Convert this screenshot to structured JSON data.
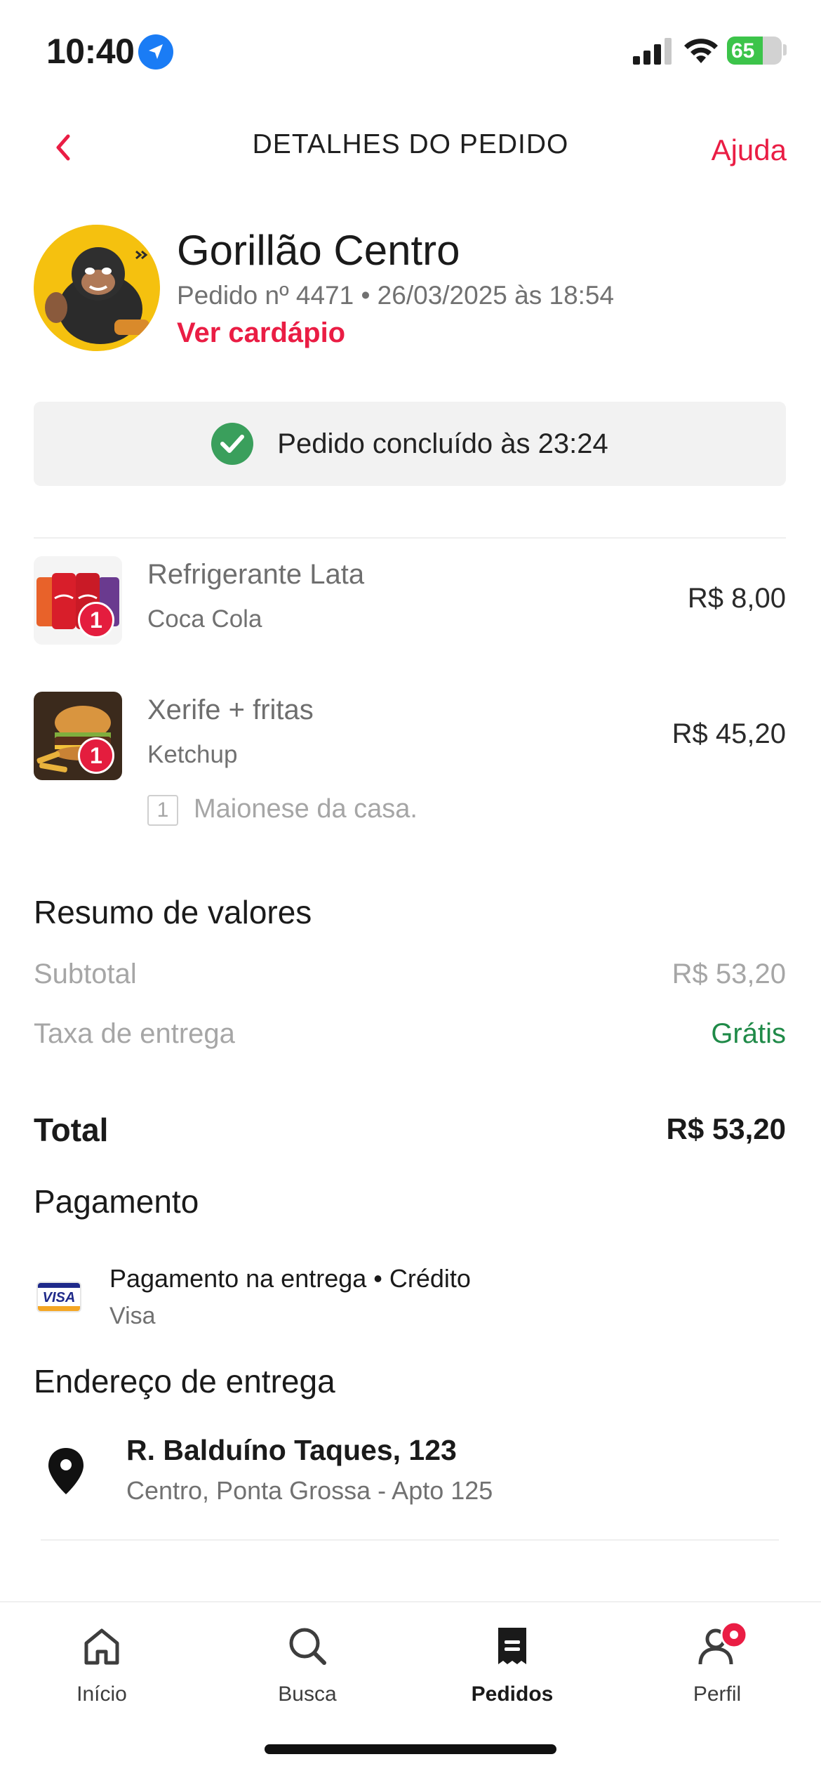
{
  "status_bar": {
    "time": "10:40",
    "battery": "65",
    "battery_level": 0.65,
    "icons": [
      "location-arrow-icon",
      "cellular-signal-icon",
      "wifi-icon",
      "battery-charging-icon"
    ]
  },
  "header": {
    "back_icon": "chevron-left-icon",
    "title": "DETALHES DO PEDIDO",
    "help_label": "Ajuda"
  },
  "restaurant": {
    "name": "Gorillão Centro",
    "order_meta": "Pedido nº 4471 • 26/03/2025 às 18:54",
    "menu_link": "Ver cardápio"
  },
  "order_status": {
    "icon": "check-circle-icon",
    "text": "Pedido concluído às 23:24"
  },
  "items": [
    {
      "qty": "1",
      "name": "Refrigerante Lata",
      "detail": "Coca Cola",
      "price": "R$ 8,00",
      "addons": []
    },
    {
      "qty": "1",
      "name": "Xerife + fritas",
      "detail": "Ketchup",
      "price": "R$ 45,20",
      "addons": [
        {
          "qty": "1",
          "name": "Maionese da casa."
        }
      ]
    }
  ],
  "summary": {
    "title": "Resumo de valores",
    "subtotal_label": "Subtotal",
    "subtotal_value": "R$ 53,20",
    "delivery_label": "Taxa de entrega",
    "delivery_value": "Grátis",
    "total_label": "Total",
    "total_value": "R$ 53,20"
  },
  "payment": {
    "title": "Pagamento",
    "method": "Pagamento na entrega • Crédito",
    "brand": "Visa",
    "card_logo_text": "VISA"
  },
  "address": {
    "title": "Endereço de entrega",
    "line1": "R. Balduíno Taques, 123",
    "line2": "Centro, Ponta Grossa - Apto 125"
  },
  "tabs": [
    {
      "label": "Início",
      "icon": "home-icon",
      "active": false
    },
    {
      "label": "Busca",
      "icon": "search-icon",
      "active": false
    },
    {
      "label": "Pedidos",
      "icon": "receipt-icon",
      "active": true
    },
    {
      "label": "Perfil",
      "icon": "profile-icon",
      "active": false
    }
  ],
  "colors": {
    "accent": "#ea1d44",
    "success": "#3a9f5c",
    "free": "#1f8a48"
  }
}
